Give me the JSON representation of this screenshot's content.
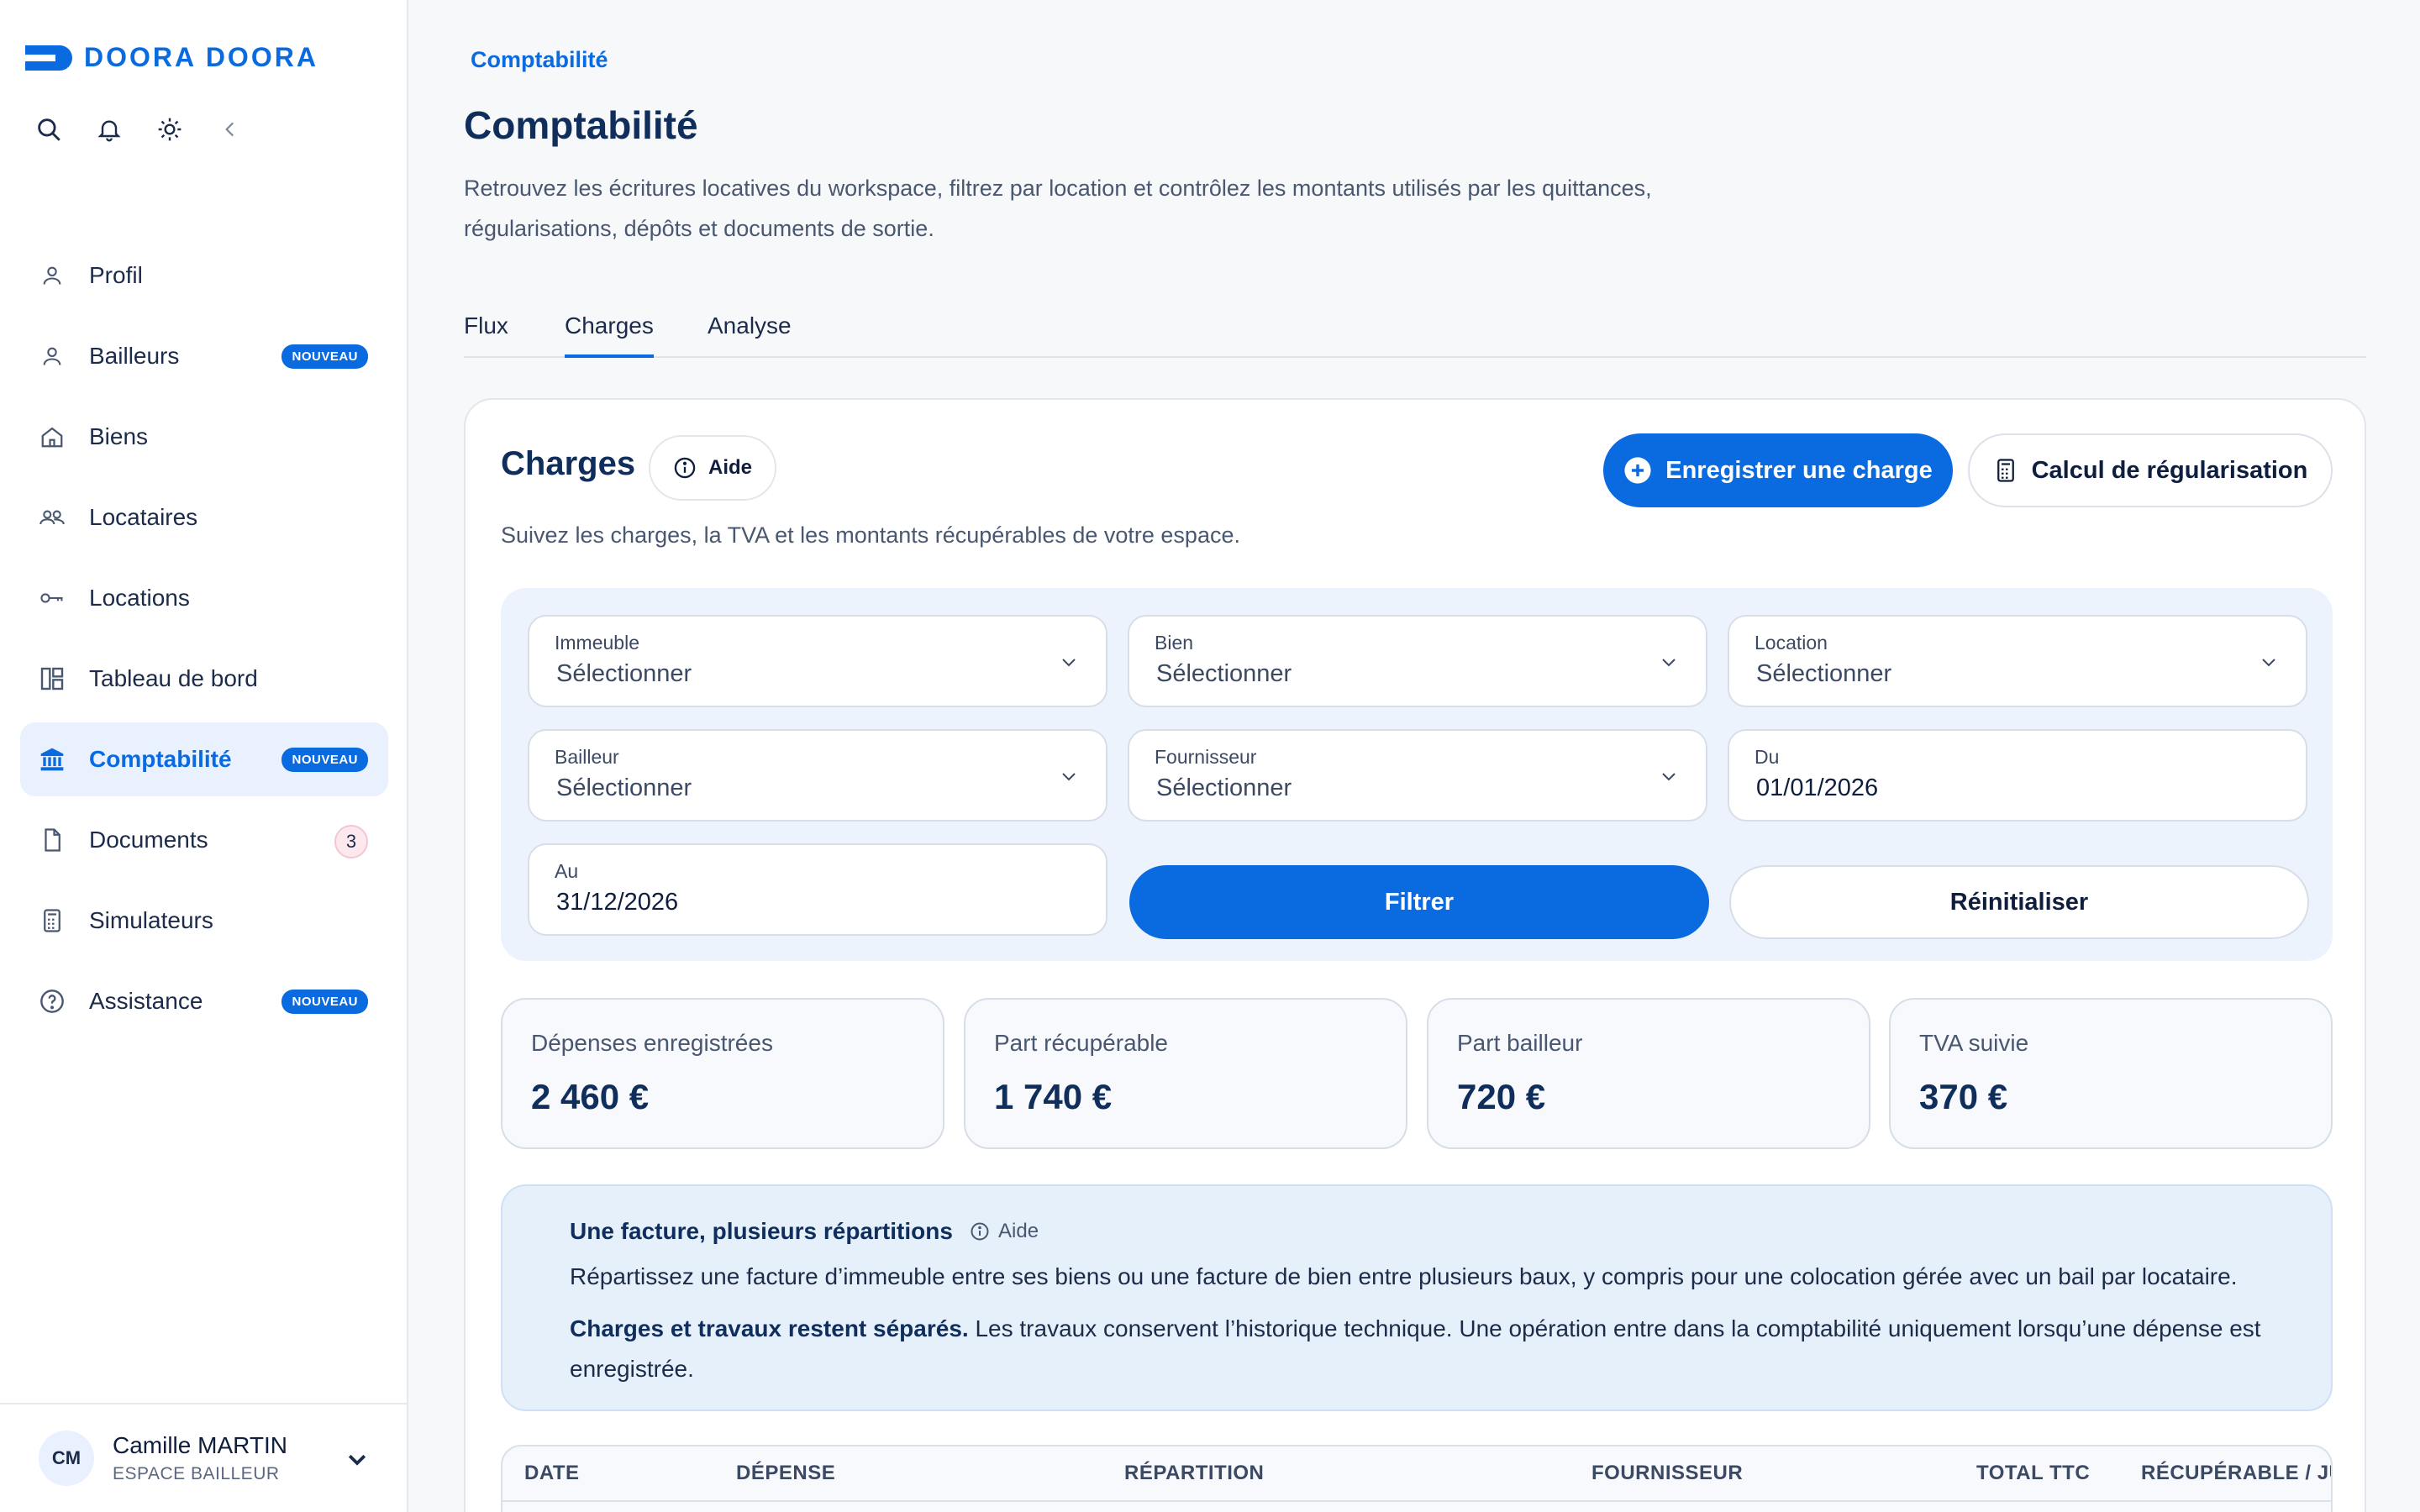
{
  "brand": {
    "name": "DOORA DOORA"
  },
  "toolbar": {
    "icons": [
      "search-icon",
      "bell-icon",
      "sun-icon",
      "chevron-left-icon"
    ]
  },
  "sidebar": {
    "items": [
      {
        "label": "Profil",
        "icon": "user-icon"
      },
      {
        "label": "Bailleurs",
        "icon": "user-icon",
        "badge": "NOUVEAU"
      },
      {
        "label": "Biens",
        "icon": "home-icon"
      },
      {
        "label": "Locataires",
        "icon": "users-icon"
      },
      {
        "label": "Locations",
        "icon": "key-icon"
      },
      {
        "label": "Tableau de bord",
        "icon": "dashboard-icon"
      },
      {
        "label": "Comptabilité",
        "icon": "bank-icon",
        "badge": "NOUVEAU",
        "active": true
      },
      {
        "label": "Documents",
        "icon": "document-icon",
        "count": "3"
      },
      {
        "label": "Simulateurs",
        "icon": "calculator-icon"
      },
      {
        "label": "Assistance",
        "icon": "help-icon",
        "badge": "NOUVEAU"
      }
    ]
  },
  "user": {
    "initials": "CM",
    "name": "Camille MARTIN",
    "role": "ESPACE BAILLEUR"
  },
  "page": {
    "breadcrumb": "Comptabilité",
    "title": "Comptabilité",
    "description_line1": "Retrouvez les écritures locatives du workspace, filtrez par location et contrôlez les montants utilisés par les quittances,",
    "description_line2": "régularisations, dépôts et documents de sortie."
  },
  "tabs": [
    {
      "label": "Flux",
      "active": false
    },
    {
      "label": "Charges",
      "active": true
    },
    {
      "label": "Analyse",
      "active": false
    }
  ],
  "charges": {
    "title": "Charges",
    "help_label": "Aide",
    "subtitle": "Suivez les charges, la TVA et les montants récupérables de votre espace.",
    "add_button": "Enregistrer une charge",
    "regul_button": "Calcul de régularisation"
  },
  "filters": {
    "immeuble": {
      "label": "Immeuble",
      "value": "Sélectionner"
    },
    "bien": {
      "label": "Bien",
      "value": "Sélectionner"
    },
    "location": {
      "label": "Location",
      "value": "Sélectionner"
    },
    "bailleur": {
      "label": "Bailleur",
      "value": "Sélectionner"
    },
    "fournisseur": {
      "label": "Fournisseur",
      "value": "Sélectionner"
    },
    "du": {
      "label": "Du",
      "value": "01/01/2026"
    },
    "au": {
      "label": "Au",
      "value": "31/12/2026"
    },
    "filter_button": "Filtrer",
    "reset_button": "Réinitialiser"
  },
  "stats": [
    {
      "label": "Dépenses enregistrées",
      "value": "2 460 €"
    },
    {
      "label": "Part récupérable",
      "value": "1 740 €"
    },
    {
      "label": "Part bailleur",
      "value": "720 €"
    },
    {
      "label": "TVA suivie",
      "value": "370 €"
    }
  ],
  "info": {
    "title": "Une facture, plusieurs répartitions",
    "help_label": "Aide",
    "text1": "Répartissez une facture d’immeuble entre ses biens ou une facture de bien entre plusieurs baux, y compris pour une colocation gérée avec un bail par locataire.",
    "text2_bold": "Charges et travaux restent séparés.",
    "text2": " Les travaux conservent l’historique technique. Une opération entre dans la comptabilité uniquement lorsqu’une dépense est enregistrée."
  },
  "table": {
    "headers": [
      "DATE",
      "DÉPENSE",
      "RÉPARTITION",
      "FOURNISSEUR",
      "TOTAL TTC",
      "RÉCUPÉRABLE / JUS"
    ]
  },
  "colors": {
    "accent": "#0a6be0",
    "navy": "#0f2e5c",
    "active_bg": "#e8f1fd"
  }
}
